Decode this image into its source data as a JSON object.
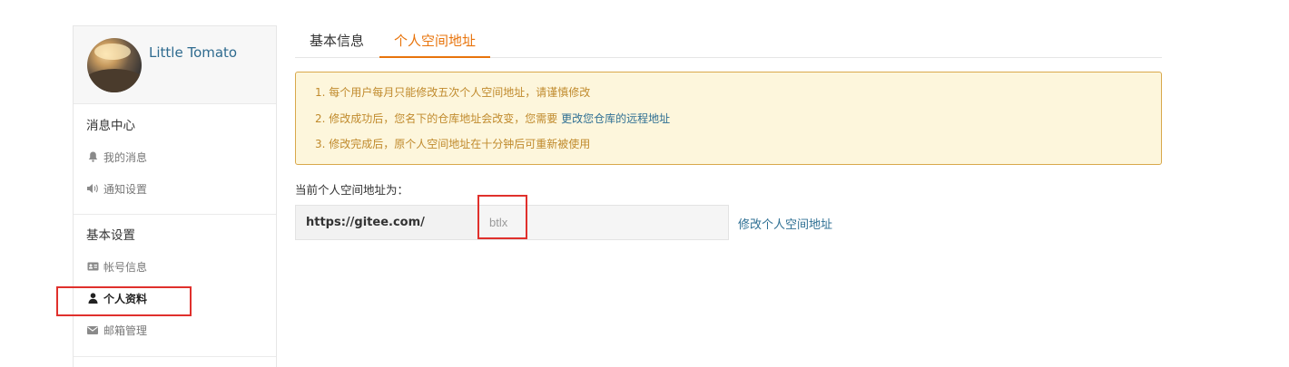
{
  "sidebar": {
    "username": "Little Tomato",
    "sections": [
      {
        "title": "消息中心",
        "items": [
          {
            "label": "我的消息",
            "icon": "bell-icon"
          },
          {
            "label": "通知设置",
            "icon": "speaker-icon"
          }
        ]
      },
      {
        "title": "基本设置",
        "items": [
          {
            "label": "帐号信息",
            "icon": "id-card-icon"
          },
          {
            "label": "个人资料",
            "icon": "user-icon",
            "active": true
          },
          {
            "label": "邮箱管理",
            "icon": "envelope-icon"
          }
        ]
      }
    ]
  },
  "tabs": [
    {
      "label": "基本信息",
      "active": false
    },
    {
      "label": "个人空间地址",
      "active": true
    }
  ],
  "notice": {
    "line1": "1. 每个用户每月只能修改五次个人空间地址，请谨慎修改",
    "line2_prefix": "2. 修改成功后，您名下的仓库地址会改变，您需要",
    "line2_link": "更改您仓库的远程地址",
    "line3": "3. 修改完成后，原个人空间地址在十分钟后可重新被使用"
  },
  "address": {
    "label": "当前个人空间地址为：",
    "prefix": "https://gitee.com/",
    "value": "btlx",
    "edit_link": "修改个人空间地址"
  },
  "colors": {
    "accent": "#e8740c",
    "link": "#2e6f93",
    "notice_bg": "#fdf6dc",
    "notice_border": "#d9a84b",
    "notice_text": "#c08a2c",
    "highlight": "#e0302c"
  }
}
